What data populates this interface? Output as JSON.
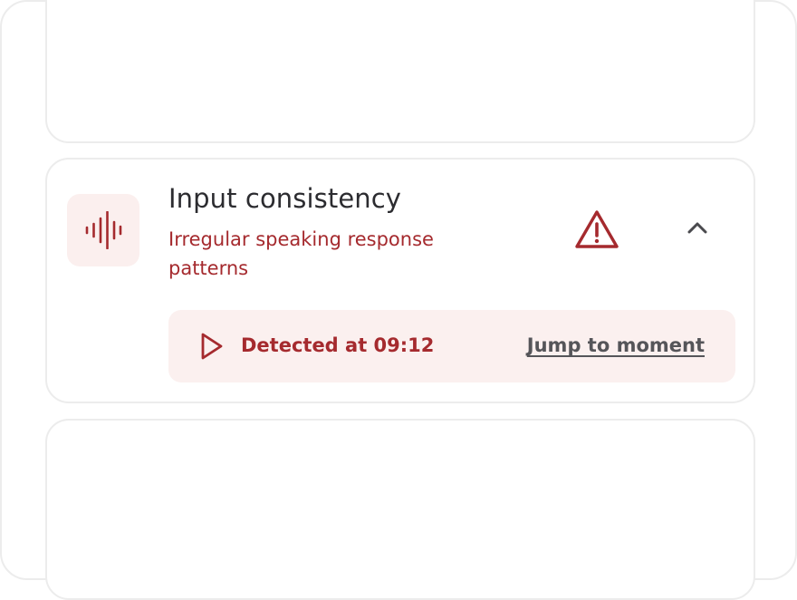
{
  "check": {
    "title": "Input consistency",
    "description": "Irregular speaking response patterns",
    "status_icon": "warning-triangle-icon",
    "category_icon": "audio-waveform-icon",
    "expand_icon": "chevron-up-icon",
    "accent_color": "#a52a2e",
    "tile_color": "#fbefee"
  },
  "detection": {
    "label": "Detected at 09:12",
    "link_label": "Jump to moment",
    "icon": "play-icon"
  }
}
